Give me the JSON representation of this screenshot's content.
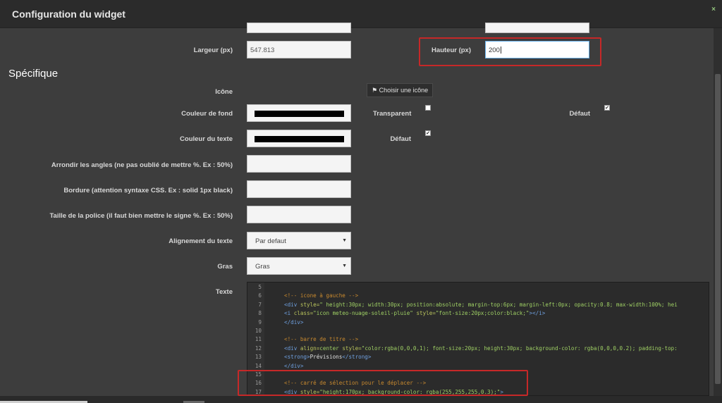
{
  "dialog": {
    "title": "Configuration du widget",
    "close_icon": "×"
  },
  "general": {
    "width_label": "Largeur (px)",
    "width_value": "547.813",
    "height_label": "Hauteur (px)",
    "height_value": "200"
  },
  "specific": {
    "section_title": "Spécifique",
    "icon_label": "Icône",
    "choose_icon_button": "Choisir une icône",
    "bg_color_label": "Couleur de fond",
    "bg_color_value": "#000000",
    "transparent_label": "Transparent",
    "default_label": "Défaut",
    "text_color_label": "Couleur du texte",
    "text_color_value": "#000000",
    "text_default_label": "Défaut",
    "radius_label": "Arrondir les angles (ne pas oublié de mettre %. Ex : 50%)",
    "border_label": "Bordure (attention syntaxe CSS. Ex : solid 1px black)",
    "font_size_label": "Taille de la police (il faut bien mettre le signe %. Ex : 50%)",
    "align_label": "Alignement du texte",
    "align_value": "Par defaut",
    "bold_label": "Gras",
    "bold_value": "Gras",
    "text_label": "Texte"
  },
  "checkboxes": {
    "transparent_checked": false,
    "default_checked": true,
    "text_default_checked": true
  },
  "editor": {
    "lines": [
      {
        "n": "5",
        "parts": []
      },
      {
        "n": "6",
        "parts": [
          [
            "c-comment",
            "<!-- icone à gauche -->"
          ]
        ]
      },
      {
        "n": "7",
        "parts": [
          [
            "c-tag",
            "<div "
          ],
          [
            "c-attr",
            "style="
          ],
          [
            "c-val",
            "\" height:30px; width:30px; position:absolute; margin-top:6px; margin-left:0px; opacity:0.8; max-width:100%; hei"
          ]
        ]
      },
      {
        "n": "8",
        "parts": [
          [
            "c-tag",
            "<i "
          ],
          [
            "c-attr",
            "class="
          ],
          [
            "c-val",
            "\"icon meteo-nuage-soleil-pluie\" "
          ],
          [
            "c-attr",
            "style="
          ],
          [
            "c-val",
            "\"font-size:20px;color:black;\""
          ],
          [
            "c-tag",
            "></i>"
          ]
        ]
      },
      {
        "n": "9",
        "parts": [
          [
            "c-tag",
            "</div>"
          ]
        ]
      },
      {
        "n": "10",
        "parts": []
      },
      {
        "n": "11",
        "parts": [
          [
            "c-comment",
            "<!-- barre de titre  -->"
          ]
        ]
      },
      {
        "n": "12",
        "parts": [
          [
            "c-tag",
            "<div "
          ],
          [
            "c-attr",
            "align="
          ],
          [
            "c-val",
            "center "
          ],
          [
            "c-attr",
            "style="
          ],
          [
            "c-val",
            "\"color:rgba(0,0,0,1); font-size:20px; height:30px; background-color: rgba(0,0,0,0.2); padding-top:"
          ]
        ]
      },
      {
        "n": "13",
        "parts": [
          [
            "c-tag",
            "<strong>"
          ],
          [
            "c-text",
            "Prévisions"
          ],
          [
            "c-tag",
            "</strong>"
          ]
        ]
      },
      {
        "n": "14",
        "parts": [
          [
            "c-tag",
            "</div>"
          ]
        ]
      },
      {
        "n": "15",
        "parts": []
      },
      {
        "n": "16",
        "parts": [
          [
            "c-comment",
            "<!-- carré de sélection pour le déplacer  -->"
          ]
        ]
      },
      {
        "n": "17",
        "parts": [
          [
            "c-tag",
            "<div "
          ],
          [
            "c-attr",
            "style="
          ],
          [
            "c-val",
            "\"height:170px;  background-color: rgba(255,255,255,0.3);\""
          ],
          [
            "c-tag",
            ">"
          ]
        ]
      }
    ]
  },
  "icons": {
    "flag": "⚑",
    "check": "✔",
    "caret": "▼"
  },
  "colors": {
    "highlight": "#c62828",
    "close_accent": "#93c47d"
  }
}
